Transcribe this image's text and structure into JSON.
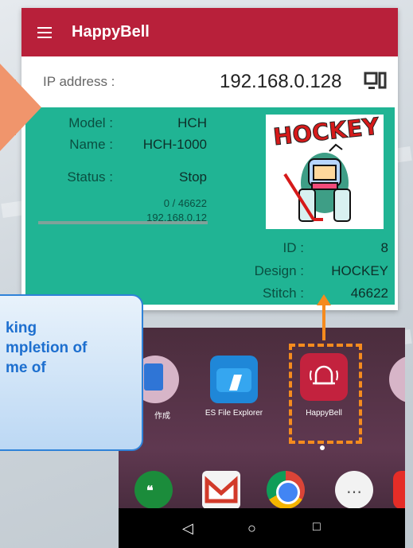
{
  "app": {
    "title": "HappyBell",
    "ip_label": "IP address :",
    "ip_value": "192.168.0.128"
  },
  "machine": {
    "model_label": "Model :",
    "model_value": "HCH",
    "name_label": "Name :",
    "name_value": "HCH-1000",
    "status_label": "Status :",
    "status_value": "Stop",
    "progress_text": "0 / 46622",
    "progress_fraction": 0,
    "machine_ip": "192.168.0.12",
    "id_label": "ID :",
    "id_value": "8",
    "design_label": "Design :",
    "design_value": "HOCKEY",
    "stitch_label": "Stitch :",
    "stitch_value": "46622",
    "thumbnail_logo_text": "HOCKEY"
  },
  "phone": {
    "app1_label": "作成",
    "app2_label": "ES File Explorer",
    "app3_label": "HappyBell"
  },
  "callout": {
    "line1": "king",
    "line2": "mpletion of",
    "line3": "me of"
  },
  "colors": {
    "appbar": "#b8203a",
    "card": "#20b494",
    "highlight": "#f58b1e",
    "callout_text": "#1d6fcf"
  }
}
